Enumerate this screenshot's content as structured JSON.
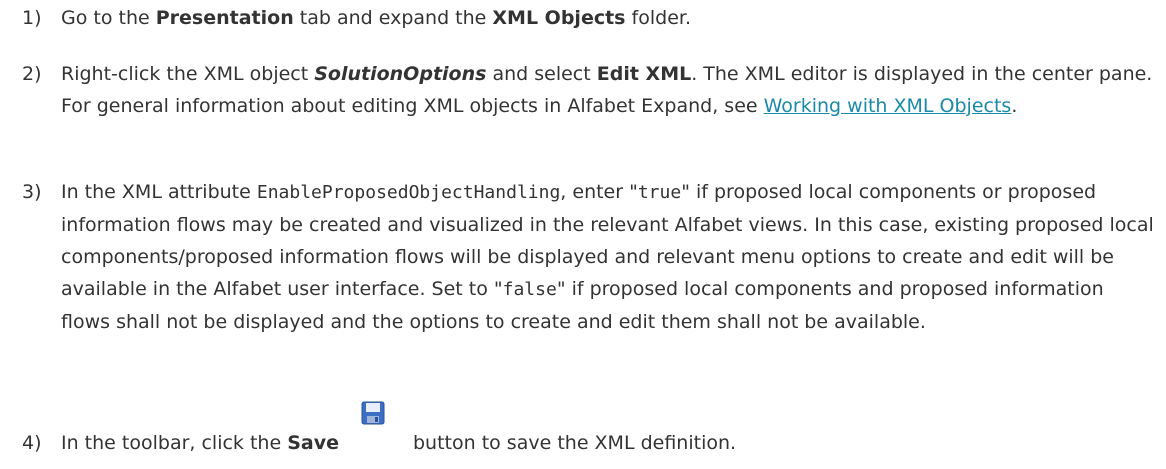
{
  "steps": [
    {
      "number": "1)",
      "parts": [
        {
          "t": "Go to the "
        },
        {
          "t": "Presentation",
          "b": true
        },
        {
          "t": " tab and expand the "
        },
        {
          "t": "XML Objects",
          "b": true
        },
        {
          "t": " folder."
        }
      ]
    },
    {
      "number": "2)",
      "parts": [
        {
          "t": "Right-click the XML object "
        },
        {
          "t": "SolutionOptions",
          "bi": true
        },
        {
          "t": " and select "
        },
        {
          "t": "Edit XML",
          "b": true
        },
        {
          "t": ". The XML editor is displayed in the center pane. For general information about editing XML objects in Alfabet Expand, see "
        },
        {
          "t": "Working with XML Objects",
          "link": true
        },
        {
          "t": "."
        }
      ]
    },
    {
      "number": "3)",
      "parts": [
        {
          "t": "In the XML attribute "
        },
        {
          "t": "EnableProposedObjectHandling",
          "code": true
        },
        {
          "t": ", enter \""
        },
        {
          "t": "true",
          "code": true
        },
        {
          "t": "\" if proposed local components or proposed information flows may be created and visualized in the relevant Alfabet views. In this case, existing proposed local components/proposed information flows will be displayed and relevant menu options to create and edit will be available in the Alfabet user interface. Set to \""
        },
        {
          "t": "false",
          "code": true
        },
        {
          "t": "\" if proposed local components and proposed information flows shall not be displayed and the options to create and edit them shall not be available."
        }
      ]
    },
    {
      "number": "4)",
      "parts": [
        {
          "t": "In the toolbar, click the "
        },
        {
          "t": "Save",
          "b": true
        },
        {
          "icon": "save-icon"
        },
        {
          "t": "button to save the XML definition."
        }
      ]
    }
  ],
  "icon_colors": {
    "save_body": "#3a6fc4",
    "save_label": "#e8eef8",
    "save_shutter": "#9fb4d6"
  }
}
